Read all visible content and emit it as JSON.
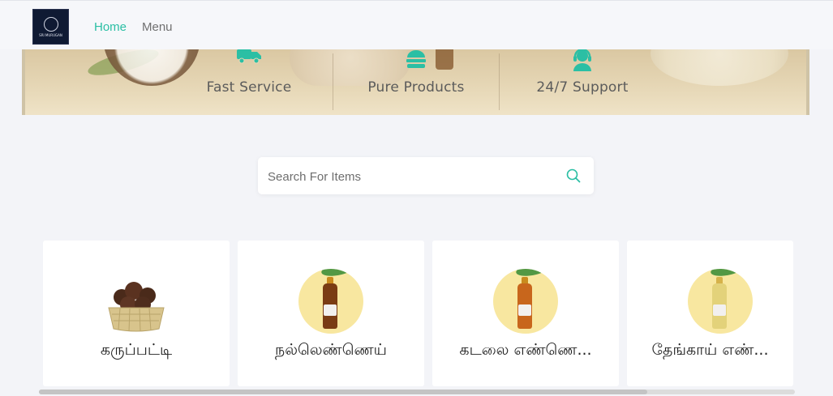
{
  "header": {
    "logo_text": "SRI MURUGAN",
    "nav": [
      {
        "label": "Home",
        "active": true
      },
      {
        "label": "Menu",
        "active": false
      }
    ]
  },
  "hero": {
    "features": [
      {
        "label": "Fast Service",
        "icon": "delivery-truck-icon"
      },
      {
        "label": "Pure Products",
        "icon": "food-icon"
      },
      {
        "label": "24/7 Support",
        "icon": "support-agent-icon"
      }
    ]
  },
  "search": {
    "placeholder": "Search For Items",
    "value": "",
    "icon": "search-icon"
  },
  "products": [
    {
      "name": "கருப்பட்டி",
      "image": "palm-jaggery-basket"
    },
    {
      "name": "நல்லெண்ணெய்",
      "image": "oil-bottle"
    },
    {
      "name": "கடலை எண்ணெ...",
      "image": "oil-bottle"
    },
    {
      "name": "தேங்காய் எண்...",
      "image": "oil-bottle"
    }
  ],
  "colors": {
    "accent": "#2bbfa4",
    "nav_inactive": "#707070",
    "page_bg": "#f3f4f8"
  }
}
